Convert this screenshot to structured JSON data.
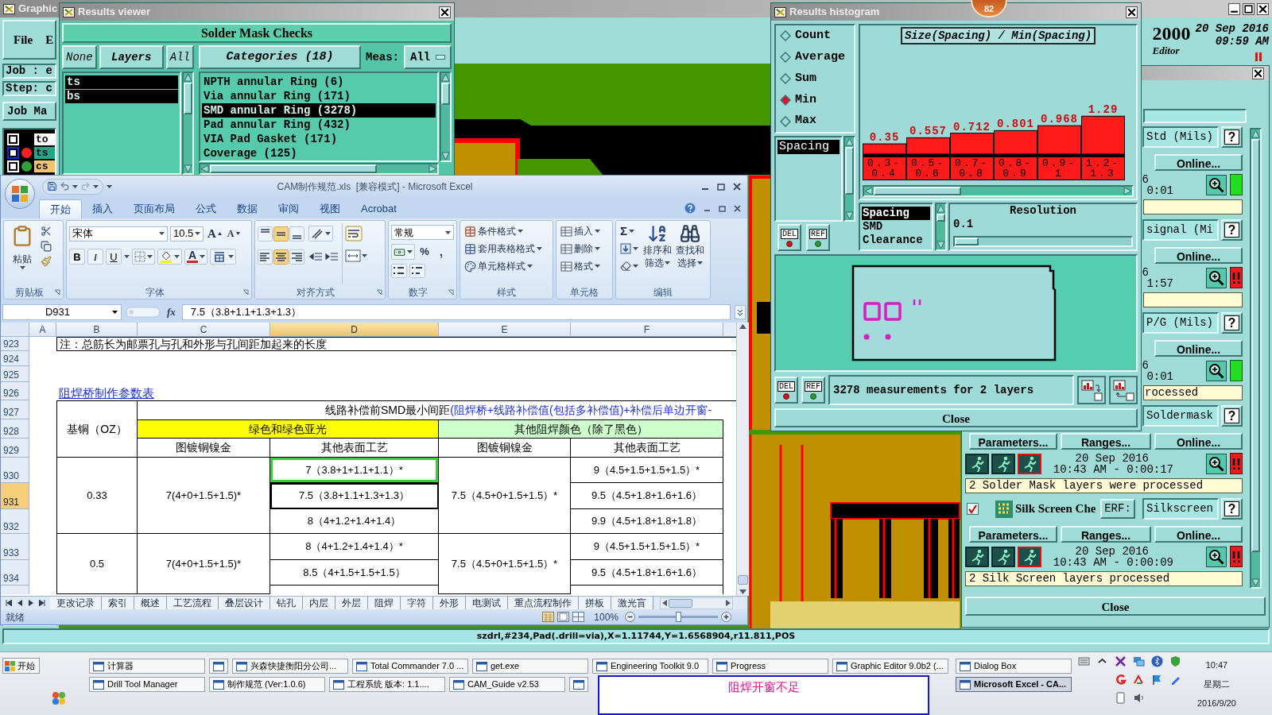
{
  "graphic_editor": {
    "title": "Graphic",
    "menu": [
      "File",
      "E"
    ],
    "job": "Job : e",
    "step": "Step: c",
    "job_matrix": "Job Ma",
    "layers": [
      {
        "name": "to",
        "color": "#ffffff",
        "box": {
          "color": "#ffffff"
        }
      },
      {
        "name": "ts",
        "color": "#22a888",
        "box": {
          "color": "#1030d0"
        },
        "dot": {
          "color": "#ff2020"
        }
      },
      {
        "name": "cs",
        "color": "#f7c46c",
        "box": {
          "color": "#ffffff"
        },
        "dot": {
          "color": "#33a033"
        }
      }
    ],
    "version": "2000",
    "date": "20 Sep 2016",
    "time": "09:59 AM",
    "mode": "Editor",
    "status_line": "szdrl,#234,Pad(.drill=via),X=1.11744,Y=1.6568904,r11.811,POS"
  },
  "results_viewer": {
    "title": "Results viewer",
    "header": "Solder Mask Checks",
    "layer_buttons": [
      "None",
      "Layers",
      "All"
    ],
    "layers": [
      {
        "name": "ts",
        "selected": true
      },
      {
        "name": "bs",
        "selected": true
      }
    ],
    "categories_button": "Categories (18)",
    "meas_label": "Meas:",
    "meas_value": "All",
    "categories": [
      {
        "label": "NPTH annular Ring (6)",
        "selected": false
      },
      {
        "label": "Via annular Ring (171)",
        "selected": false
      },
      {
        "label": "SMD annular Ring (3278)",
        "selected": true
      },
      {
        "label": "Pad annular Ring (432)",
        "selected": false
      },
      {
        "label": "VIA Pad Gasket (171)",
        "selected": false
      },
      {
        "label": "Coverage (125)",
        "selected": false
      }
    ]
  },
  "excel": {
    "title": "CAM制作规范.xls  [兼容模式] - Microsoft Excel",
    "tabs": [
      {
        "label": "开始",
        "selected": true
      },
      {
        "label": "插入",
        "selected": false
      },
      {
        "label": "页面布局",
        "selected": false
      },
      {
        "label": "公式",
        "selected": false
      },
      {
        "label": "数据",
        "selected": false
      },
      {
        "label": "审阅",
        "selected": false
      },
      {
        "label": "视图",
        "selected": false
      },
      {
        "label": "Acrobat",
        "selected": false
      }
    ],
    "ribbon": {
      "paste": "粘贴",
      "clipboard": "剪贴板",
      "font_name": "宋体",
      "font_size": "10.5",
      "grow": "A",
      "shrink": "A",
      "bold": "B",
      "italic": "I",
      "underline": "U",
      "font_color": "A",
      "font": "字体",
      "vertical_align": [
        {
          "selected": false
        },
        {
          "selected": true
        },
        {
          "selected": false
        }
      ],
      "horizontal_align": [
        {
          "selected": false
        },
        {
          "selected": true
        },
        {
          "selected": false
        }
      ],
      "alignment": "对齐方式",
      "number_format": "常规",
      "percent": "%",
      "comma": ",",
      "number": "数字",
      "styles": [
        "条件格式",
        "套用表格格式",
        "单元格样式"
      ],
      "styles_group": "样式",
      "cells": [
        "插入",
        "删除",
        "格式"
      ],
      "cells_group": "单元格",
      "sum": "Σ",
      "sort": [
        "排序和",
        "筛选"
      ],
      "find": [
        "查找和",
        "选择"
      ],
      "editing": "编辑"
    },
    "name_box": "D931",
    "fx": "fx",
    "formula": "7.5（3.8+1.1+1.3+1.3）",
    "columns": [
      {
        "label": "A",
        "selected": false
      },
      {
        "label": "B",
        "selected": false
      },
      {
        "label": "C",
        "selected": false
      },
      {
        "label": "D",
        "selected": true
      },
      {
        "label": "E",
        "selected": false
      },
      {
        "label": "F",
        "selected": false
      }
    ],
    "rows": [
      {
        "label": "923",
        "selected": false
      },
      {
        "label": "924",
        "selected": false
      },
      {
        "label": "925",
        "selected": false
      },
      {
        "label": "926",
        "selected": false
      },
      {
        "label": "927",
        "selected": false
      },
      {
        "label": "928",
        "selected": false
      },
      {
        "label": "929",
        "selected": false
      },
      {
        "label": "930",
        "selected": false
      },
      {
        "label": "931",
        "selected": true
      },
      {
        "label": "932",
        "selected": false
      },
      {
        "label": "933",
        "selected": false
      },
      {
        "label": "934",
        "selected": false
      }
    ],
    "note": "注：总筋长为邮票孔与孔和外形与孔间距加起来的长度",
    "link": "阻焊桥制作参数表",
    "caption": "线路补偿前SMD最小间距",
    "caption_highlight": "(阻焊桥+线路补偿值(包括多补偿值)+补偿后单边开窗-",
    "base_copper": "基铜（OZ）",
    "groups": [
      {
        "label": "绿色和绿色亚光",
        "color": "#ffff00"
      },
      {
        "label": "其他阻焊颜色（除了黑色）",
        "color": "#ccffcc"
      }
    ],
    "subheaders": [
      "图镀铜镍金",
      "其他表面工艺",
      "图镀铜镍金",
      "其他表面工艺"
    ],
    "blocks": [
      {
        "copper": "0.33",
        "c": "7(4+0+1.5+1.5)*",
        "d": [
          {
            "text": "7（3.8+1+1.1+1.1）*",
            "selected": false,
            "highlighted": true
          },
          {
            "text": "7.5（3.8+1.1+1.3+1.3）",
            "selected": true,
            "highlighted": false
          },
          {
            "text": "8（4+1.2+1.4+1.4）",
            "selected": false,
            "highlighted": false
          }
        ],
        "e": "7.5（4.5+0+1.5+1.5）*",
        "f": [
          "9（4.5+1.5+1.5+1.5）*",
          "9.5（4.5+1.8+1.6+1.6）",
          "9.9（4.5+1.8+1.8+1.8）"
        ]
      },
      {
        "copper": "0.5",
        "c": "7(4+0+1.5+1.5)*",
        "d": [
          {
            "text": "8（4+1.2+1.4+1.4）*",
            "selected": false,
            "highlighted": false
          },
          {
            "text": "8.5（4+1.5+1.5+1.5）",
            "selected": false,
            "highlighted": false
          }
        ],
        "e": "7.5（4.5+0+1.5+1.5）*",
        "f": [
          "9（4.5+1.5+1.5+1.5）*",
          "9.5（4.5+1.8+1.6+1.6）"
        ]
      }
    ],
    "sheet_tabs": [
      "更改记录",
      "索引",
      "概述",
      "工艺流程",
      "叠层设计",
      "钻孔",
      "内层",
      "外层",
      "阻焊",
      "字符",
      "外形",
      "电测试",
      "重点流程制作",
      "拼板",
      "激光盲"
    ],
    "status": "就绪",
    "zoom": "100%",
    "zoom_slider": {
      "level": 0.5
    }
  },
  "histogram": {
    "title": "Results histogram",
    "modes": [
      {
        "label": "Count",
        "selected": false
      },
      {
        "label": "Average",
        "selected": false
      },
      {
        "label": "Sum",
        "selected": false
      },
      {
        "label": "Min",
        "selected": true
      },
      {
        "label": "Max",
        "selected": false
      }
    ],
    "measures": [
      {
        "label": "Spacing",
        "selected": true
      }
    ],
    "list_buttons": [
      "DEL",
      "REF"
    ],
    "chart_title": "Size(Spacing) / Min(Spacing)",
    "chart_data": {
      "type": "bar",
      "categories": [
        "0.3-0.4",
        "0.5-0.6",
        "0.7-0.8",
        "0.8-0.9",
        "0.9-1",
        "1.2-1.3"
      ],
      "series": [
        {
          "color": "#ff1a1a",
          "values": [
            0.35,
            0.557,
            0.712,
            0.801,
            0.968,
            1.29
          ]
        }
      ],
      "data_labels": true
    },
    "types": [
      {
        "label": "Spacing",
        "selected": true
      },
      {
        "label": "SMD",
        "selected": false
      },
      {
        "label": "Clearance",
        "selected": false
      }
    ],
    "resolution": {
      "label": "Resolution",
      "value": "0.1",
      "level": 0
    },
    "bottom_buttons": [
      "DEL",
      "REF"
    ],
    "info": "3278 measurements for 2 layers",
    "close": "Close"
  },
  "badge": "82",
  "checklist": {
    "items": [
      {
        "kind": "partial",
        "field": "Std (Mils)",
        "help": "?",
        "online": "Online...",
        "date": "6",
        "time": "0:01",
        "error": false
      },
      {
        "kind": "partial",
        "field": "signal (Mi",
        "help": "?",
        "online": "Online...",
        "date": "6",
        "time": "1:57",
        "error": true
      },
      {
        "kind": "partial",
        "field": "P/G (Mils)",
        "help": "?",
        "online": "Online...",
        "date": "6",
        "time": "0:01",
        "error": false,
        "message": "rocessed"
      },
      {
        "kind": "full",
        "field": "Soldermask",
        "help": "?",
        "parameters": "Parameters...",
        "ranges": "Ranges...",
        "online": "Online...",
        "date": "20 Sep 2016",
        "time": "10:43 AM - 0:00:17",
        "error": true,
        "message": "2 Solder Mask layers were processed"
      },
      {
        "kind": "full",
        "checked": true,
        "name": "Silk Screen Che",
        "erf": "ERF:",
        "field": "Silkscreen",
        "help": "?",
        "parameters": "Parameters...",
        "ranges": "Ranges...",
        "online": "Online...",
        "date": "20 Sep 2016",
        "time": "10:43 AM - 0:00:09",
        "error": true,
        "message": "2 Silk Screen layers processed"
      }
    ],
    "close": "Close"
  },
  "taskbar": {
    "start": "开始",
    "top_row": [
      {
        "kind": "app",
        "label": "计算器",
        "selected": false
      },
      {
        "kind": "icon",
        "selected": false
      },
      {
        "kind": "app",
        "label": "兴森快捷衡阳分公司...",
        "selected": false
      },
      {
        "kind": "app",
        "label": "Total Commander 7.0 ...",
        "selected": false
      },
      {
        "kind": "app",
        "label": "get.exe",
        "selected": false
      },
      {
        "kind": "app",
        "label": "Engineering Toolkit 9.0",
        "selected": false
      },
      {
        "kind": "app",
        "label": "Progress",
        "selected": false
      },
      {
        "kind": "app",
        "label": "Graphic Editor 9.0b2 (...",
        "selected": false
      },
      {
        "kind": "app",
        "label": "Dialog Box",
        "selected": false
      }
    ],
    "bottom_row": [
      {
        "kind": "app",
        "label": "Drill Tool Manager",
        "selected": false
      },
      {
        "kind": "app",
        "label": "制作规范 (Ver:1.0.6)",
        "selected": false
      },
      {
        "kind": "app",
        "label": "工程系统  版本: 1.1....",
        "selected": false
      },
      {
        "kind": "app",
        "label": "CAM_Guide v2.53",
        "selected": false
      },
      {
        "kind": "icon",
        "selected": false
      },
      {
        "kind": "app",
        "label": "Microsoft Excel - CA...",
        "selected": true
      }
    ],
    "clock": {
      "time": "10:47",
      "weekday": "星期二",
      "date": "2016/9/20"
    }
  },
  "popup": {
    "message": "阻焊开窗不足"
  }
}
